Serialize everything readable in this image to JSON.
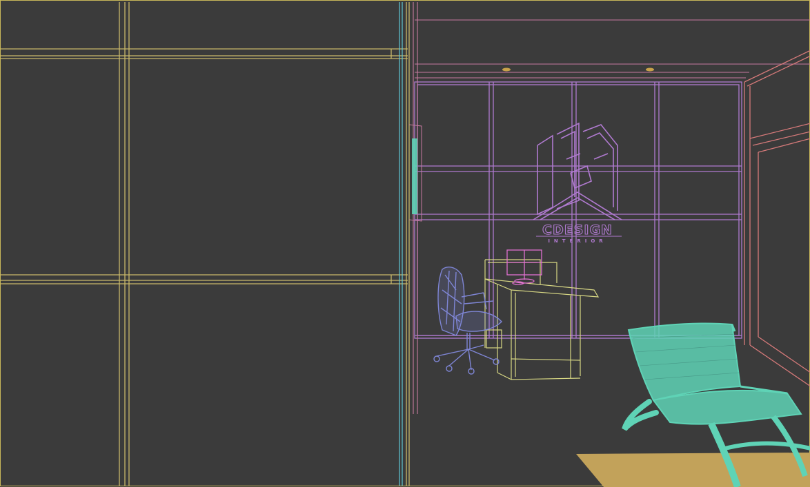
{
  "viewport": {
    "background": "#3b3b3b",
    "wire_colors": {
      "window_frame": "#c9b86a",
      "wall_panels": "#b07ad0",
      "ceiling": "#c77aa0",
      "right_wall": "#d77a7a",
      "desk": "#d8d884",
      "office_chair": "#7f86d6",
      "lounge_chair": "#5fd3b6",
      "rug": "#c2a25a",
      "cyan_edge": "#5fc7d6"
    }
  },
  "logo": {
    "brand": "CDESIGN",
    "subtitle": "INTERIOR",
    "icon": "building-house-icon"
  }
}
